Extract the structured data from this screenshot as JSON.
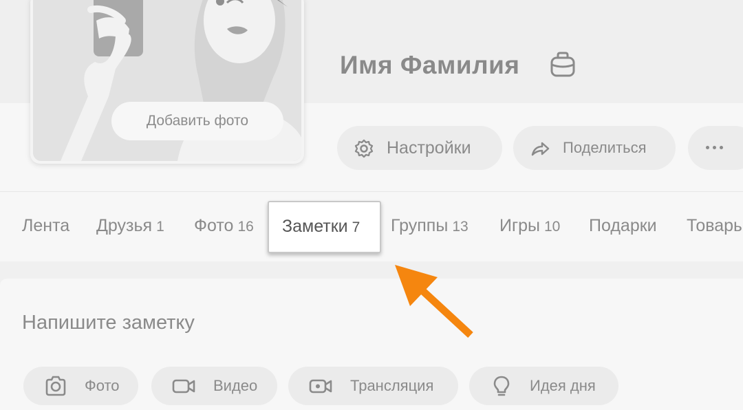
{
  "profile": {
    "name": "Имя Фамилия",
    "add_photo_label": "Добавить фото"
  },
  "actions": {
    "settings_label": "Настройки",
    "share_label": "Поделиться"
  },
  "tabs": [
    {
      "label": "Лента",
      "count": ""
    },
    {
      "label": "Друзья",
      "count": "1"
    },
    {
      "label": "Фото",
      "count": "16"
    },
    {
      "label": "Заметки",
      "count": "7"
    },
    {
      "label": "Группы",
      "count": "13"
    },
    {
      "label": "Игры",
      "count": "10"
    },
    {
      "label": "Подарки",
      "count": ""
    },
    {
      "label": "Товары",
      "count": ""
    }
  ],
  "composer": {
    "placeholder": "Напишите заметку",
    "chips": [
      {
        "label": "Фото",
        "icon": "camera-icon"
      },
      {
        "label": "Видео",
        "icon": "video-camera-icon"
      },
      {
        "label": "Трансляция",
        "icon": "live-stream-icon"
      },
      {
        "label": "Идея дня",
        "icon": "lightbulb-icon"
      }
    ]
  },
  "colors": {
    "highlight_arrow": "#f5860f",
    "text_gray": "#8a8a8a",
    "active_tab_text": "#555555"
  }
}
